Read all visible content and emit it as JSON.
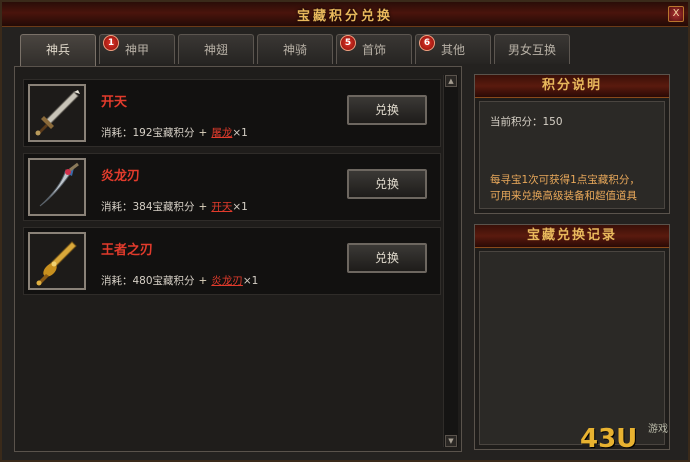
{
  "window": {
    "title": "宝藏积分兑换",
    "close_glyph": "X"
  },
  "tabs": [
    {
      "label": "神兵",
      "active": true,
      "badge": ""
    },
    {
      "label": "神甲",
      "active": false,
      "badge": "1"
    },
    {
      "label": "神翅",
      "active": false,
      "badge": ""
    },
    {
      "label": "神骑",
      "active": false,
      "badge": ""
    },
    {
      "label": "首饰",
      "active": false,
      "badge": "5"
    },
    {
      "label": "其他",
      "active": false,
      "badge": "6"
    },
    {
      "label": "男女互换",
      "active": false,
      "badge": ""
    }
  ],
  "items": [
    {
      "name": "开天",
      "cost_prefix": "消耗：192宝藏积分",
      "plus": "+",
      "req_item": "屠龙",
      "req_qty": "×1",
      "button": "兑换",
      "icon": "broad-sword-icon"
    },
    {
      "name": "炎龙刃",
      "cost_prefix": "消耗：384宝藏积分",
      "plus": "+",
      "req_item": "开天",
      "req_qty": "×1",
      "button": "兑换",
      "icon": "curved-blade-icon"
    },
    {
      "name": "王者之刃",
      "cost_prefix": "消耗：480宝藏积分",
      "plus": "+",
      "req_item": "炎龙刃",
      "req_qty": "×1",
      "button": "兑换",
      "icon": "golden-blade-icon"
    }
  ],
  "info": {
    "header": "积分说明",
    "points_label": "当前积分：150",
    "desc_line1": "每寻宝1次可获得1点宝藏积分，",
    "desc_line2": "可用来兑换高级装备和超值道具"
  },
  "records": {
    "header": "宝藏兑换记录"
  },
  "watermark": {
    "logo": "43U",
    "sub": "游戏"
  },
  "colors": {
    "item_name": "#e23b2c",
    "header_text": "#e8b85c",
    "desc_text": "#e8a85a"
  }
}
